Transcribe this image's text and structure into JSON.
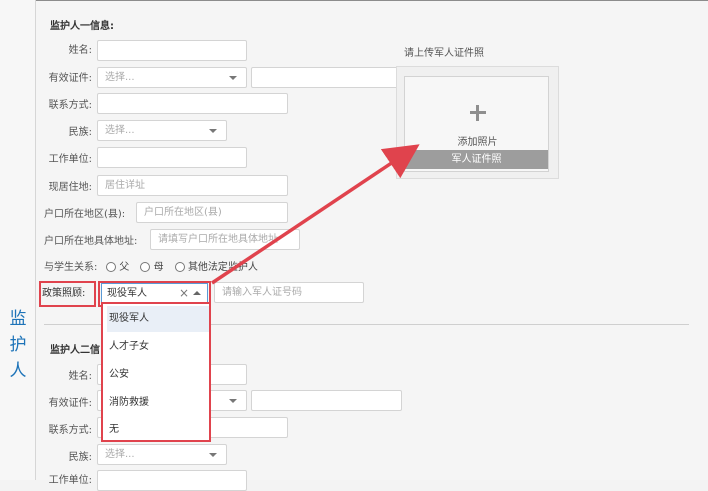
{
  "side_label": "监\n护\n人",
  "guardian1": {
    "title": "监护人一信息:",
    "fields": {
      "name": {
        "label": "姓名:",
        "value": ""
      },
      "id_type": {
        "label": "有效证件:",
        "placeholder": "选择...",
        "value2": ""
      },
      "contact": {
        "label": "联系方式:",
        "value": ""
      },
      "ethnicity": {
        "label": "民族:",
        "placeholder": "选择..."
      },
      "work_unit": {
        "label": "工作单位:",
        "value": ""
      },
      "residence": {
        "label": "现居住地:",
        "placeholder": "居住详址"
      },
      "hukou_region": {
        "label": "户口所在地区(县):",
        "placeholder": "户口所在地区(县)"
      },
      "hukou_address": {
        "label": "户口所在地具体地址:",
        "placeholder": "请填写户口所在地具体地址"
      },
      "relation": {
        "label": "与学生关系:",
        "options": [
          "父",
          "母",
          "其他法定监护人"
        ]
      },
      "policy": {
        "label": "政策照顾:",
        "selected": "现役军人",
        "clear_symbol": "×",
        "cert_placeholder": "请输入军人证号码",
        "options": [
          "现役军人",
          "人才子女",
          "公安",
          "消防救援",
          "无"
        ]
      }
    },
    "upload": {
      "hint": "请上传军人证件照",
      "plus_symbol": "+",
      "add_label": "添加照片",
      "bar_label": "军人证件照"
    }
  },
  "guardian2": {
    "title_visible": "监护人二信",
    "fields": {
      "name": {
        "label": "姓名:"
      },
      "id_type": {
        "label": "有效证件:"
      },
      "contact": {
        "label": "联系方式:"
      },
      "ethnicity": {
        "label": "民族:",
        "placeholder": "选择..."
      },
      "work_unit": {
        "label": "工作单位:"
      }
    }
  },
  "colors": {
    "highlight": "#e0434d",
    "side_label": "#1d73b8",
    "upload_bar": "#9d9d9d"
  }
}
